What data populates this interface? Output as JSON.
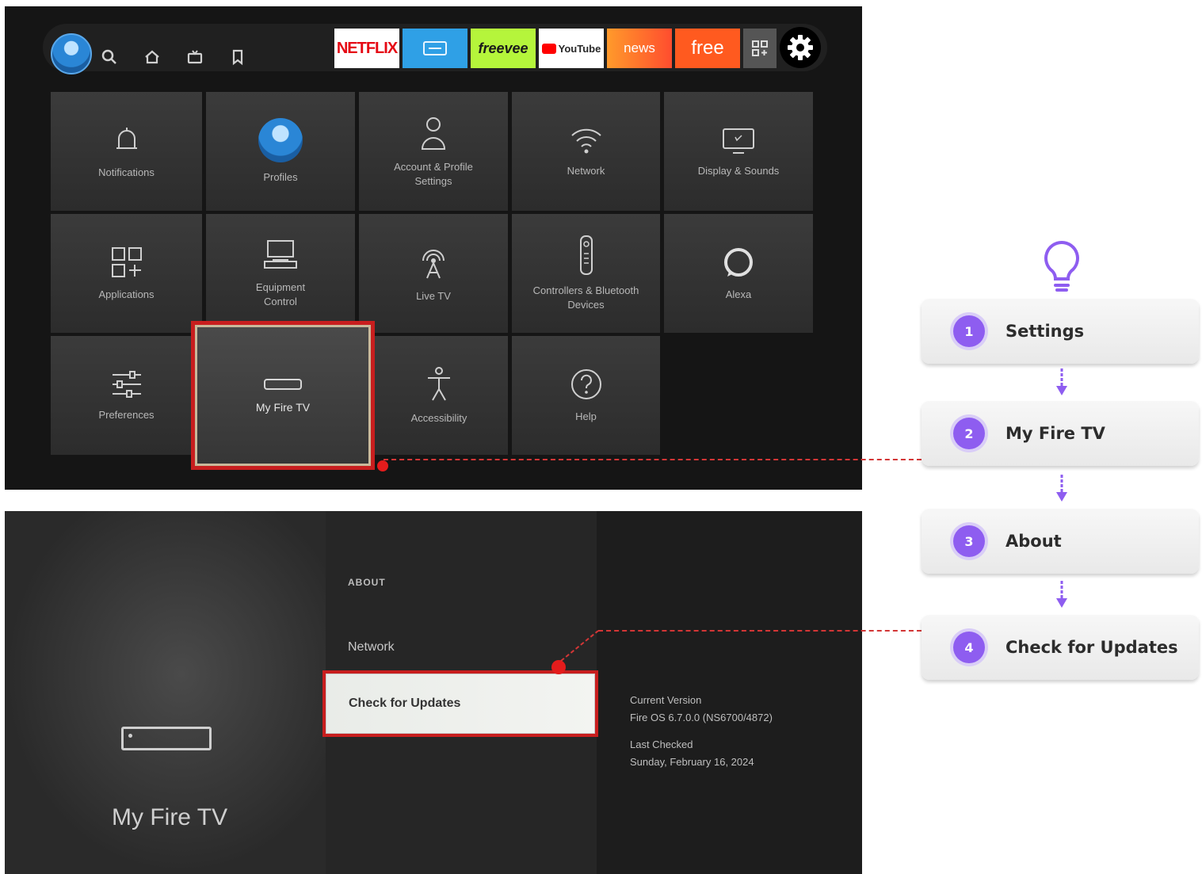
{
  "top_bar": {
    "apps": [
      {
        "label": "NETFLIX",
        "icon": "netflix-logo",
        "bg": "#ffffff",
        "fg": "#e50914"
      },
      {
        "label": "",
        "icon": "prime-video-logo",
        "bg": "#2fa0e6",
        "fg": "#ffffff"
      },
      {
        "label": "freevee",
        "icon": "freevee-logo",
        "bg": "#b5f53b",
        "fg": "#1a1a1a"
      },
      {
        "label": "YouTube",
        "icon": "youtube-logo",
        "bg": "#ffffff",
        "fg": "#282828"
      },
      {
        "label": "news",
        "icon": "news-logo",
        "bg": "#ff5a2b",
        "fg": "#ffffff"
      },
      {
        "label": "free",
        "icon": "free-logo",
        "bg": "#ff5a1f",
        "fg": "#ffffff"
      }
    ],
    "nav_icons": [
      "search-icon",
      "home-icon",
      "live-tv-icon",
      "bookmark-icon"
    ]
  },
  "settings_tiles": [
    {
      "label": "Notifications",
      "icon": "bell-icon"
    },
    {
      "label": "Profiles",
      "icon": "profile-avatar-icon"
    },
    {
      "label": "Account & Profile Settings",
      "icon": "person-icon"
    },
    {
      "label": "Network",
      "icon": "wifi-icon"
    },
    {
      "label": "Display & Sounds",
      "icon": "display-icon"
    },
    {
      "label": "Applications",
      "icon": "apps-grid-icon"
    },
    {
      "label": "Equipment Control",
      "icon": "equipment-icon"
    },
    {
      "label": "Live TV",
      "icon": "antenna-icon"
    },
    {
      "label": "Controllers & Bluetooth Devices",
      "icon": "remote-icon"
    },
    {
      "label": "Alexa",
      "icon": "alexa-ring-icon"
    },
    {
      "label": "Preferences",
      "icon": "sliders-icon"
    },
    {
      "label": "My Fire TV",
      "icon": "fire-tv-device-icon",
      "selected": true
    },
    {
      "label": "Accessibility",
      "icon": "accessibility-icon"
    },
    {
      "label": "Help",
      "icon": "help-icon"
    }
  ],
  "my_fire_tv": {
    "title": "My Fire TV",
    "section_label": "ABOUT",
    "menu": [
      "Network",
      "Check for Updates"
    ],
    "selected_item": "Check for Updates",
    "current_version_label": "Current Version",
    "current_version_value": "Fire OS 6.7.0.0 (NS6700/4872)",
    "last_checked_label": "Last Checked",
    "last_checked_value": "Sunday, February 16, 2024"
  },
  "steps": [
    {
      "number": "1",
      "label": "Settings"
    },
    {
      "number": "2",
      "label": "My Fire TV"
    },
    {
      "number": "3",
      "label": "About"
    },
    {
      "number": "4",
      "label": "Check for Updates"
    }
  ],
  "colors": {
    "step_accent": "#8e5df0",
    "highlight_red": "#c81e1e",
    "tip_icon": "#8e5df0"
  }
}
